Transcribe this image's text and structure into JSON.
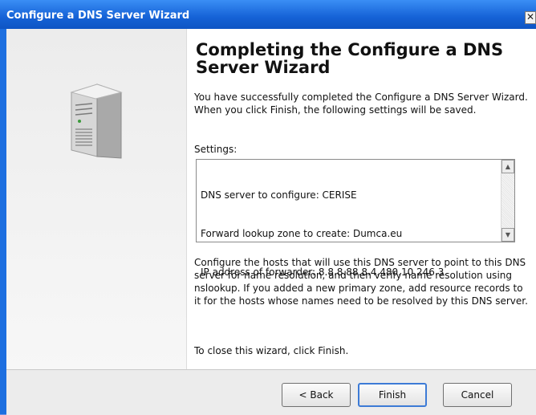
{
  "window": {
    "title": "Configure a DNS Server Wizard",
    "close_glyph": "✕"
  },
  "main": {
    "heading": "Completing the Configure a DNS Server Wizard",
    "intro": "You have successfully completed the Configure a DNS Server Wizard. When you click Finish, the following settings will be saved.",
    "settings_label": "Settings:",
    "settings_lines": [
      "DNS server to configure: CERISE",
      "Forward lookup zone to create: Dumca.eu",
      "IP address of forwarder: 8.8.8.88.8.4.480.10.246.3"
    ],
    "instructions": "Configure the hosts that will use this DNS server to point to this DNS server for name resolution, and then verify name resolution using nslookup. If you added a new primary zone, add resource records to it for the hosts whose names need to be resolved by this DNS server.",
    "closing": "To close this wizard, click Finish."
  },
  "buttons": {
    "back": "< Back",
    "finish": "Finish",
    "cancel": "Cancel"
  },
  "icons": {
    "server": "server-icon",
    "scroll_up": "scroll-up-arrow-icon",
    "scroll_down": "scroll-down-arrow-icon",
    "close": "close-icon"
  },
  "colors": {
    "titlebar": "#1562d6",
    "focus_border": "#3d7bd6"
  }
}
